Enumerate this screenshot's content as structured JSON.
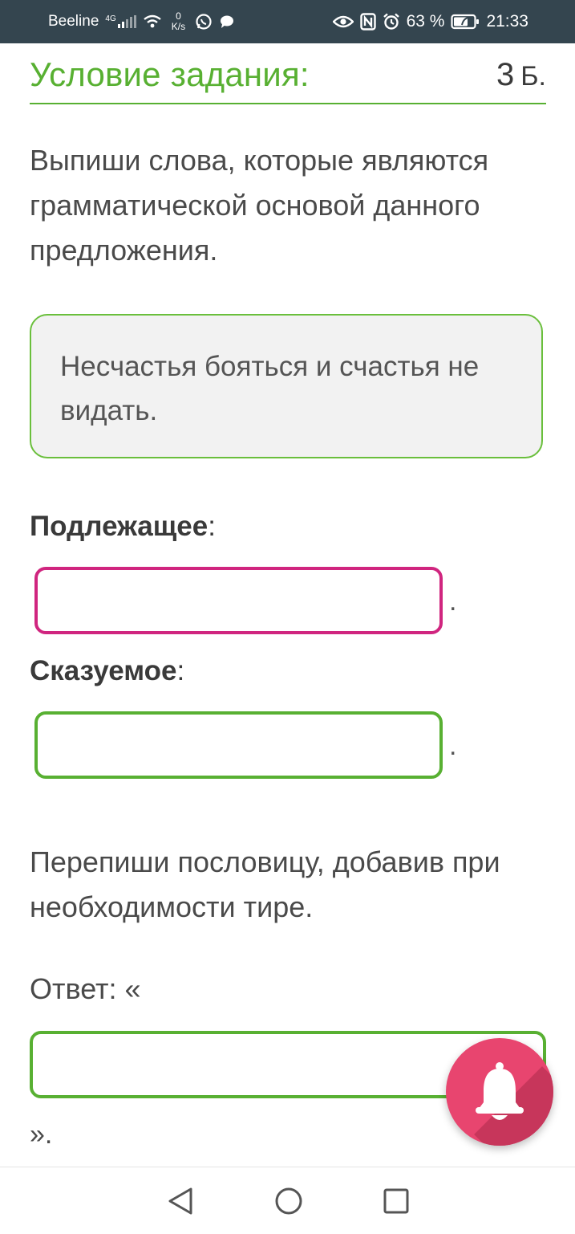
{
  "status_bar": {
    "carrier": "Beeline",
    "network": "4G",
    "net_speed_value": "0",
    "net_speed_unit": "K/s",
    "battery": "63 %",
    "time": "21:33",
    "icons": [
      "signal-icon",
      "wifi-icon",
      "whatsapp-icon",
      "message-icon",
      "eye-icon",
      "nfc-icon",
      "alarm-icon",
      "battery-icon"
    ]
  },
  "task": {
    "title": "Условие задания:",
    "points_value": "3",
    "points_unit": "Б.",
    "instruction": "Выпиши слова, которые являются грамматической основой данного предложения.",
    "sentence": "Несчастья бояться и счастья не видать.",
    "subject_label": "Подлежащее",
    "predicate_label": "Сказуемое",
    "colon": ":",
    "subject_value": "",
    "predicate_value": "",
    "period": ".",
    "instruction2": "Перепиши пословицу, добавив при необходимости тире.",
    "answer_label": "Ответ: «",
    "answer_value": "",
    "answer_close": "»."
  },
  "colors": {
    "accent_green": "#58b032",
    "input_active_pink": "#d0257f",
    "fab_pink": "#e8456f",
    "status_bar_bg": "#34454f"
  },
  "fab": {
    "icon": "bell-icon"
  },
  "nav_bar": {
    "icons": [
      "back-icon",
      "home-icon",
      "recents-icon"
    ]
  }
}
